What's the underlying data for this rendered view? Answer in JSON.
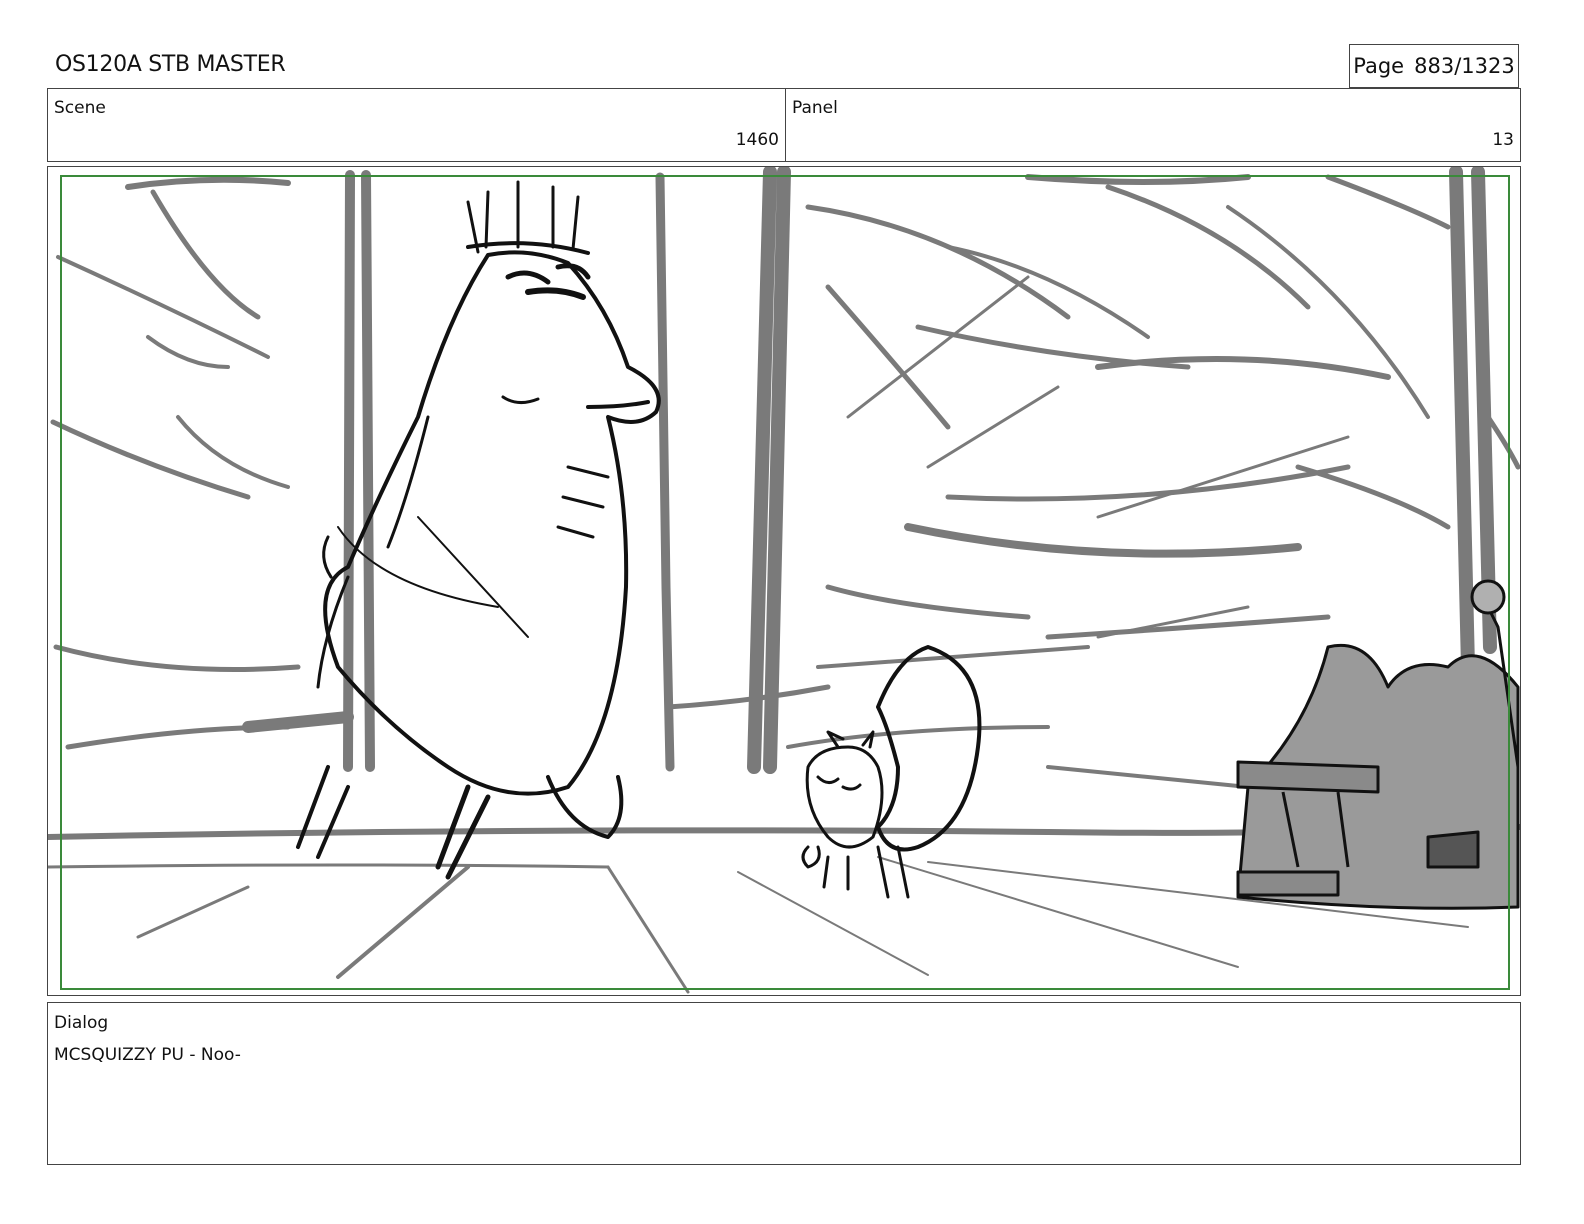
{
  "header": {
    "title": "OS120A STB MASTER",
    "page_label": "Page",
    "page_number": "883/1323"
  },
  "info": {
    "scene_label": "Scene",
    "scene_value": "1460",
    "panel_label": "Panel",
    "panel_value": "13"
  },
  "dialog": {
    "label": "Dialog",
    "text": "MCSQUIZZY PU - Noo-"
  },
  "colors": {
    "safe_frame": "#3a8a3a",
    "sketch_gray": "#7a7a7a",
    "sketch_ink": "#111111"
  }
}
